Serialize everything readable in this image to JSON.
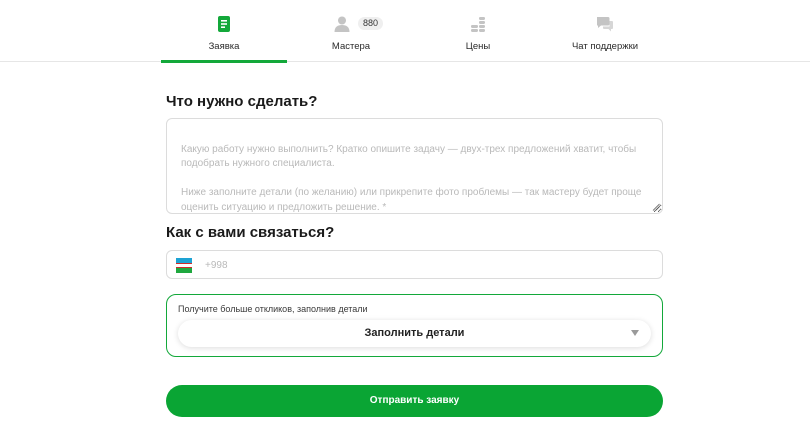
{
  "tabs": [
    {
      "label": "Заявка",
      "icon": "document-icon",
      "active": true
    },
    {
      "label": "Мастера",
      "icon": "person-icon",
      "badge": "880"
    },
    {
      "label": "Цены",
      "icon": "coins-icon"
    },
    {
      "label": "Чат поддержки",
      "icon": "chat-icon"
    }
  ],
  "task": {
    "heading": "Что нужно сделать?",
    "placeholder": "Какую работу нужно выполнить? Кратко опишите задачу — двух-трех предложений хватит, чтобы подобрать нужного специалиста.\n\nНиже заполните детали (по желанию) или прикрепите фото проблемы — так мастеру будет проще оценить ситуацию и предложить решение. *"
  },
  "contact": {
    "heading": "Как с вами связаться?",
    "phone_placeholder": "+998",
    "flag_icon": "uzbekistan-flag-icon"
  },
  "details": {
    "hint": "Получите больше откликов, заполнив детали",
    "button_label": "Заполнить детали"
  },
  "submit_label": "Отправить заявку",
  "colors": {
    "accent": "#13a83a",
    "button": "#0aa534",
    "inactive_icon": "#c4c4c4"
  }
}
